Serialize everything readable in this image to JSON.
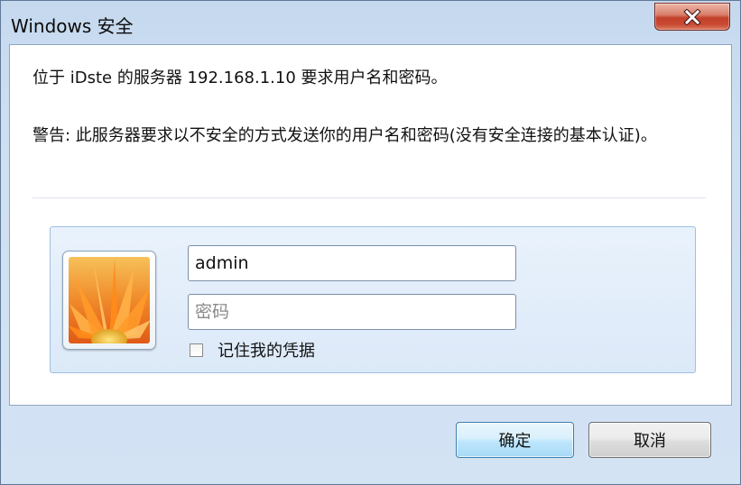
{
  "window": {
    "title": "Windows 安全"
  },
  "dialog": {
    "message": "位于 iDste 的服务器 192.168.1.10 要求用户名和密码。",
    "warning": "警告: 此服务器要求以不安全的方式发送你的用户名和密码(没有安全连接的基本认证)。"
  },
  "credentials": {
    "username_value": "admin",
    "password_placeholder": "密码",
    "remember_label": "记住我的凭据",
    "remember_checked": false
  },
  "buttons": {
    "ok_label": "确定",
    "cancel_label": "取消"
  },
  "colors": {
    "window_frame": "#c9dcf0",
    "close_button": "#c94a33",
    "panel": "#dce9f8",
    "ok_button": "#bee6fd"
  },
  "icons": {
    "close": "close-icon",
    "avatar": "user-tile-flower"
  }
}
